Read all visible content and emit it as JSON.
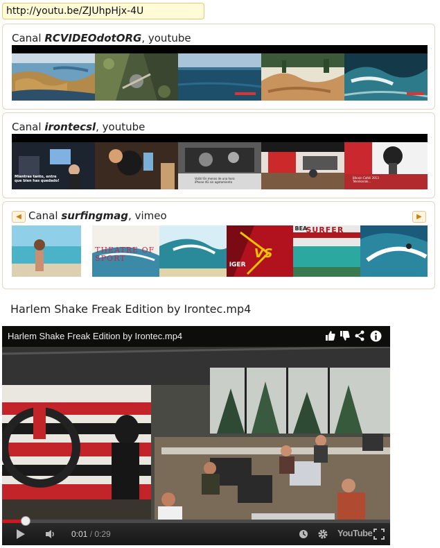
{
  "url": "http://youtu.be/ZJUhpHjx-4U",
  "channels": [
    {
      "prefix": "Canal ",
      "name": "RCVIDEOdotORG",
      "suffix": ", youtube"
    },
    {
      "prefix": "Canal ",
      "name": "irontecsl",
      "suffix": ", youtube"
    },
    {
      "prefix": "Canal ",
      "name": "surfingmag",
      "suffix": ", vimeo"
    }
  ],
  "thumb_text": {
    "irontec_1": "Mientras tanto, entre\nque bien has quedado!",
    "irontec_3": "Voilà! En menos de una hora\niPhone 4G sin agotamiento",
    "irontec_6": "Bitcoin Cafeli 2013\nTeknikariak...",
    "surf_2": "THEATRE OF SPORT",
    "surf_4": "VS",
    "surf_4b": "IGER",
    "surf_5": "SURFER",
    "surf_5b": "BEA"
  },
  "nav": {
    "prev": "◀",
    "next": "▶"
  },
  "video": {
    "title": "Harlem Shake Freak Edition by Irontec.mp4",
    "overlay_title": "Harlem Shake Freak Edition by Irontec.mp4",
    "time_current": "0:01",
    "time_separator": " / ",
    "time_total": "0:29",
    "progress_fraction": 0.06,
    "youtube_logo": "YouTube"
  },
  "icons": [
    "like-icon",
    "dislike-icon",
    "share-icon",
    "info-icon",
    "play-icon",
    "volume-icon",
    "clock-icon",
    "gear-icon",
    "youtube-logo",
    "fullscreen-icon"
  ]
}
